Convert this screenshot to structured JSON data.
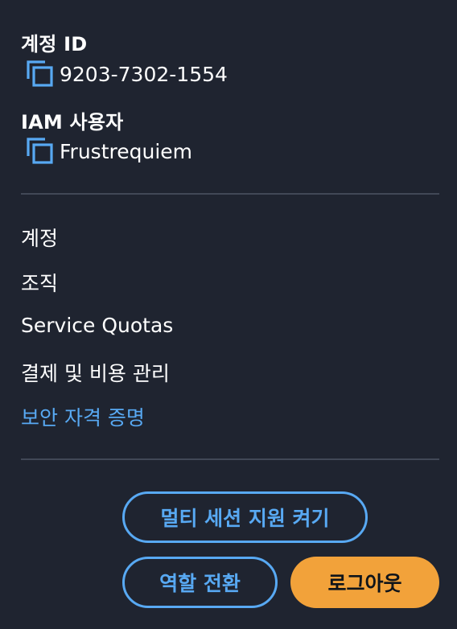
{
  "account": {
    "title": "계정 ID",
    "value": "9203-7302-1554",
    "copy_icon": "copy-icon"
  },
  "iam_user": {
    "title": "IAM 사용자",
    "value": "Frustrequiem",
    "copy_icon": "copy-icon"
  },
  "menu": {
    "items": [
      {
        "label": "계정"
      },
      {
        "label": "조직"
      },
      {
        "label": "Service Quotas"
      },
      {
        "label": "결제 및 비용 관리"
      },
      {
        "label": "보안 자격 증명"
      }
    ]
  },
  "buttons": {
    "multi_session": "멀티 세션 지원 켜기",
    "switch_role": "역할 전환",
    "sign_out": "로그아웃"
  },
  "colors": {
    "background": "#1f2430",
    "accent_blue": "#58a9f3",
    "divider": "#414856",
    "sign_out_bg": "#f2a23a"
  }
}
